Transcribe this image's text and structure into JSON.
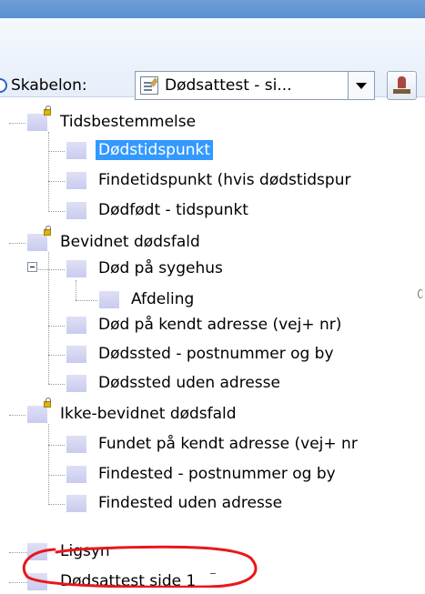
{
  "toolbar": {
    "template_label": "Skabelon:",
    "template_selected": "Dødsattest - si...",
    "icons": [
      "radio-icon",
      "document-icon",
      "chevron-down-icon",
      "stamp-icon"
    ]
  },
  "tree": {
    "selected_item": "Dødstidspunkt",
    "groups": [
      {
        "label": "Tidsbestemmelse",
        "locked": true,
        "children": [
          "Dødstidspunkt",
          "Findetidspunkt (hvis dødstidspur",
          "Dødfødt - tidspunkt"
        ]
      },
      {
        "label": "Bevidnet dødsfald",
        "locked": true,
        "children": [
          "Død på sygehus",
          "Afdeling",
          "Død på kendt adresse (vej+ nr)",
          "Dødssted - postnummer og by",
          "Dødssted uden adresse"
        ]
      },
      {
        "label": "Ikke-bevidnet dødsfald",
        "locked": true,
        "children": [
          "Fundet på kendt adresse (vej+ nr",
          "Findested - postnummer og by",
          "Findested uden adresse"
        ]
      }
    ],
    "root_items": [
      "Ligsyn",
      "Dødsattest side 1"
    ]
  },
  "colors": {
    "selection": "#3399ff",
    "annotation": "#e8171d",
    "node_square": "#d3d5f2",
    "lock": "#e2b400"
  }
}
